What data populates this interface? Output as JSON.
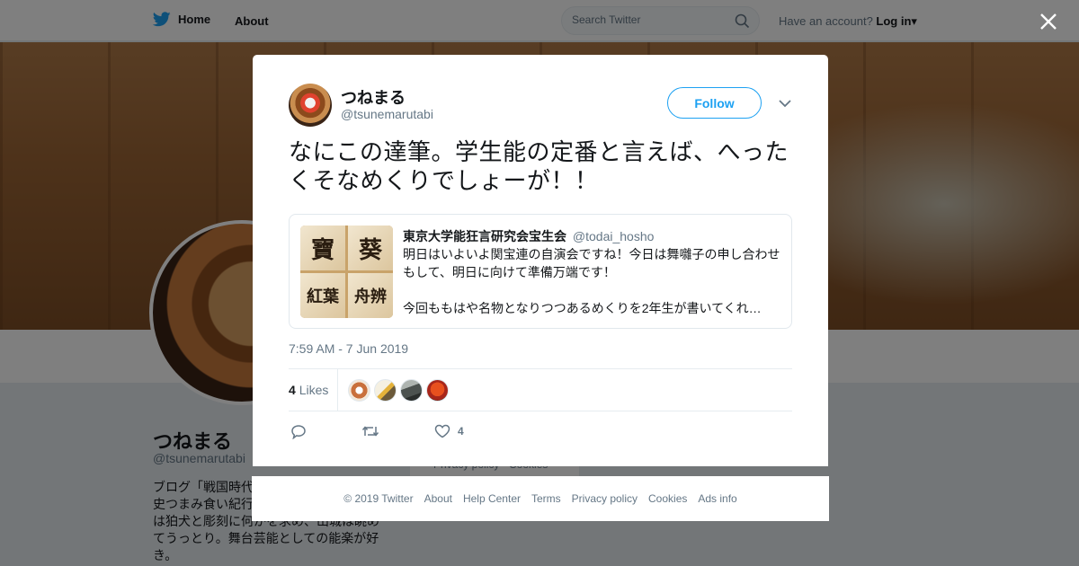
{
  "nav": {
    "home_label": "Home",
    "about_label": "About",
    "search_placeholder": "Search Twitter",
    "account_prompt": "Have an account?",
    "login_label": "Log in"
  },
  "profile": {
    "name": "つねまる",
    "handle": "@tsunemarutabi",
    "bio_lines": [
      "ブログ「戦国時代",
      "史つまみ食い紀行",
      "は狛犬と彫刻に何かを求め、山城は眺め",
      "てうっとり。舞台芸能としての能楽が好",
      "き。"
    ],
    "footer_links": "Privacy policy · Cookies"
  },
  "tweet": {
    "author_name": "つねまる",
    "author_handle": "@tsunemarutabi",
    "follow_label": "Follow",
    "text": "なにこの達筆。学生能の定番と言えば、へったくそなめくりでしょーが！！",
    "quote": {
      "author_name": "東京大学能狂言研究会宝生会",
      "author_handle": "@todai_hosho",
      "lines": [
        "明日はいよいよ関宝連の自演会ですね！今日は舞囃子の申し合わせ",
        "もして、明日に向けて準備万端です！",
        "",
        "今回ももはや名物となりつつあるめくりを2年生が書いてくれ…"
      ],
      "thumbnail_chars": [
        "寶",
        "葵",
        "紅葉",
        "舟辨"
      ]
    },
    "timestamp": "7:59 AM - 7 Jun 2019",
    "likes_count": "4",
    "likes_label": "Likes",
    "like_action_count": "4"
  },
  "footer": {
    "links": [
      "© 2019 Twitter",
      "About",
      "Help Center",
      "Terms",
      "Privacy policy",
      "Cookies",
      "Ads info"
    ]
  },
  "colors": {
    "brand": "#1da1f2",
    "muted": "#657786",
    "text": "#14171a"
  }
}
